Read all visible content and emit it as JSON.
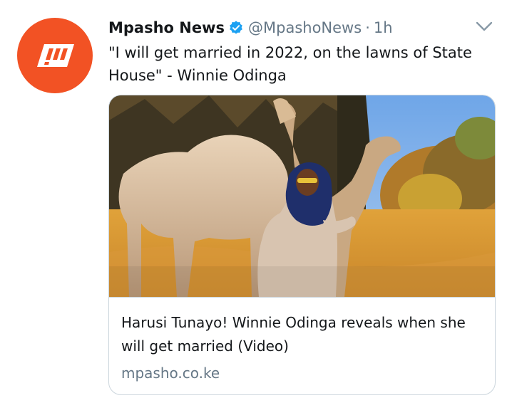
{
  "tweet": {
    "display_name": "Mpasho News",
    "handle": "@MpashoNews",
    "separator": "·",
    "time": "1h",
    "text": "\"I will get married in 2022, on the lawns of State House\" - Winnie Odinga",
    "avatar_icon": "mpasho-logo-icon",
    "verified_icon": "verified-badge-icon",
    "menu_icon": "chevron-down-icon"
  },
  "card": {
    "title": "Harusi Tunayo! Winnie Odinga reveals when she will get married (Video)",
    "domain": "mpasho.co.ke",
    "image_description_icon": "photo-woman-with-camels"
  },
  "colors": {
    "brand": "#f25224",
    "verified": "#1da1f2",
    "secondary_text": "#657786",
    "border": "#ccd6dd"
  }
}
